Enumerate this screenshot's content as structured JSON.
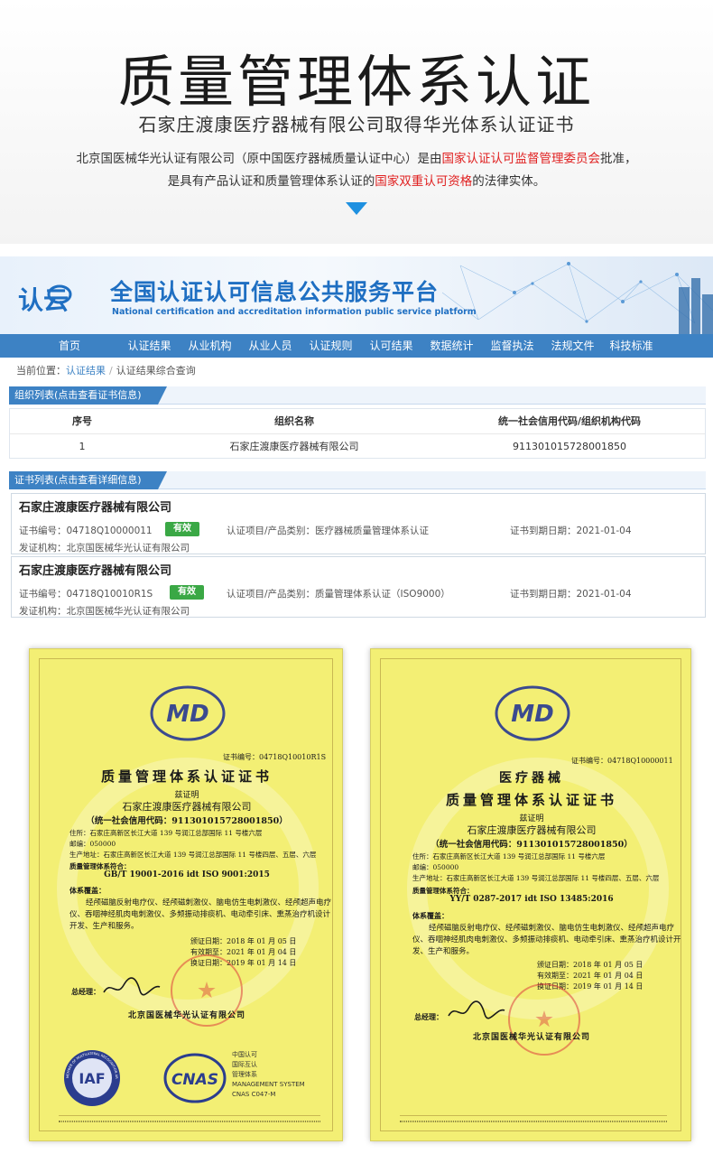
{
  "intro": {
    "title": "质量管理体系认证",
    "subtitle": "石家庄渡康医疗器械有限公司取得华光体系认证证书",
    "desc_line1_a": "北京国医械华光认证有限公司（原中国医疗器械质量认证中心）是由",
    "desc_line1_red": "国家认证认可监督管理委员会",
    "desc_line1_b": "批准，",
    "desc_line2_a": "是具有产品认证和质量管理体系认证的",
    "desc_line2_red": "国家双重认可资格",
    "desc_line2_b": "的法律实体。",
    "colors": {
      "red": "#e02020",
      "arrow": "#1e90e0"
    }
  },
  "platform": {
    "logo_text": "认云",
    "title": "全国认证认可信息公共服务平台",
    "title_en": "National certification and accreditation information public service platform",
    "nav": [
      "首页",
      "认证结果",
      "从业机构",
      "从业人员",
      "认证规则",
      "认可结果",
      "数据统计",
      "监督执法",
      "法规文件",
      "科技标准"
    ],
    "breadcrumb": {
      "label": "当前位置：",
      "current": "认证结果",
      "sep": "/",
      "page": "认证结果综合查询"
    },
    "org_section": "组织列表(点击查看证书信息)",
    "org_table": {
      "headers": [
        "序号",
        "组织名称",
        "统一社会信用代码/组织机构代码"
      ],
      "rows": [
        [
          "1",
          "石家庄渡康医疗器械有限公司",
          "911301015728001850"
        ]
      ]
    },
    "cert_section": "证书列表(点击查看详细信息)",
    "certs": [
      {
        "org": "石家庄渡康医疗器械有限公司",
        "no": "证书编号：04718Q10000011",
        "status": "有效",
        "project": "认证项目/产品类别：医疗器械质量管理体系认证",
        "expiry": "证书到期日期：2021-01-04",
        "issuer": "发证机构：北京国医械华光认证有限公司"
      },
      {
        "org": "石家庄渡康医疗器械有限公司",
        "no": "证书编号：04718Q10010R1S",
        "status": "有效",
        "project": "认证项目/产品类别：质量管理体系认证（ISO9000）",
        "expiry": "证书到期日期：2021-01-04",
        "issuer": "发证机构：北京国医械华光认证有限公司"
      }
    ],
    "colors": {
      "nav": "#3d82c4",
      "badge": "#3aa845"
    }
  },
  "cert_left": {
    "logo": "MD",
    "cert_no": "证书编号：04718Q10010R1S",
    "title": "质量管理体系认证证书",
    "hereby": "兹证明",
    "org": "石家庄渡康医疗器械有限公司",
    "credit": "（统一社会信用代码：911301015728001850）",
    "address": "住所：石家庄高新区长江大道 139 号润江总部国际 11 号楼六层",
    "postcode": "邮编：050000",
    "site": "生产地址：石家庄高新区长江大道 139 号润江总部国际 11 号楼四层、五层、六层",
    "system_label": "质量管理体系符合：",
    "standard": "GB/T 19001-2016 idt ISO 9001:2015",
    "scope_label": "体系覆盖：",
    "scope": "经颅磁脑反射电疗仪、经颅磁刺激仪、脑电仿生电刺激仪、经颅超声电疗仪、吞咽神经肌肉电刺激仪、多频振动排痰机、电动牵引床、熏蒸治疗机设计开发、生产和服务。",
    "issue": "颁证日期：2018 年 01 月 05 日",
    "valid": "有效期至：2021 年 01 月 04 日",
    "reissue": "换证日期：2019 年 01 月 14 日",
    "gm_label": "总经理：",
    "issuer": "北京国医械华光认证有限公司",
    "iaf": "IAF",
    "iaf_ring": "MEMBER OF MULTILATERAL RECOGNITION ARRANGEMENT",
    "cnas": "CNAS",
    "cnas_lines": [
      "中国认可",
      "国际互认",
      "管理体系",
      "MANAGEMENT SYSTEM",
      "CNAS C047-M"
    ]
  },
  "cert_right": {
    "logo": "MD",
    "cert_no": "证书编号：04718Q10000011",
    "title1": "医疗器械",
    "title2": "质量管理体系认证证书",
    "hereby": "兹证明",
    "org": "石家庄渡康医疗器械有限公司",
    "credit": "（统一社会信用代码：911301015728001850）",
    "address": "住所：石家庄高新区长江大道 139 号润江总部国际 11 号楼六层",
    "postcode": "邮编：050000",
    "site": "生产地址：石家庄高新区长江大道 139 号润江总部国际 11 号楼四层、五层、六层",
    "system_label": "质量管理体系符合：",
    "standard": "YY/T 0287-2017 idt ISO 13485:2016",
    "scope_label": "体系覆盖：",
    "scope": "经颅磁脑反射电疗仪、经颅磁刺激仪、脑电仿生电刺激仪、经颅超声电疗仪、吞咽神经肌肉电刺激仪、多频振动排痰机、电动牵引床、熏蒸治疗机设计开发、生产和服务。",
    "issue": "颁证日期：2018 年 01 月 05 日",
    "valid": "有效期至：2021 年 01 月 04 日",
    "reissue": "换证日期：2019 年 01 月 14 日",
    "gm_label": "总经理：",
    "issuer": "北京国医械华光认证有限公司"
  }
}
